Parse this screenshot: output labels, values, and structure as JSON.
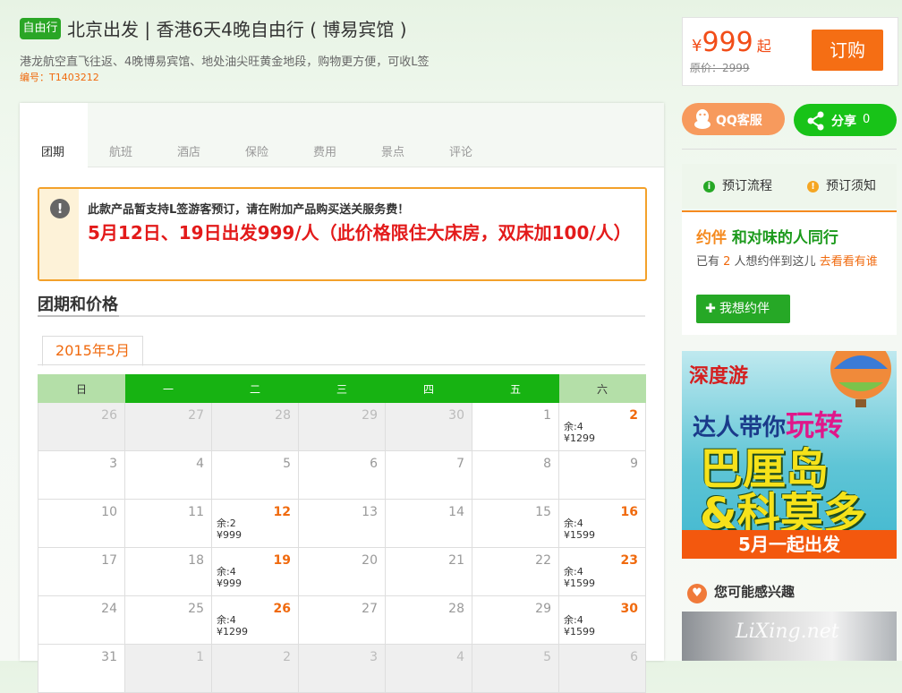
{
  "header": {
    "badge": "自由行",
    "title": "北京出发 | 香港6天4晚自由行 ( 博易宾馆 )",
    "subtitle": "港龙航空直飞往返、4晚博易宾馆、地处油尖旺黄金地段，购物更方便，可收L签",
    "code": "编号：T1403212"
  },
  "price": {
    "currency": "¥",
    "amount": "999",
    "suffix": "起",
    "original": "原价：2999",
    "buy_label": "订购"
  },
  "social": {
    "qq_label": "QQ客服",
    "share_label": "分享",
    "share_count": "0"
  },
  "process": {
    "booking_flow": "预订流程",
    "booking_notes": "预订须知"
  },
  "companion": {
    "logo": "约伴",
    "title": "和对味的人同行",
    "text_prefix": "已有 ",
    "count": "2",
    "text_mid": " 人想约伴到这儿 ",
    "link": "去看看有谁",
    "button": "我想约伴"
  },
  "ad": {
    "logo": "深度游",
    "line1_a": "达人带你",
    "line1_b": "玩转",
    "line2": "巴厘岛",
    "line3": "&科莫多",
    "bar": "5月一起出发"
  },
  "interest": {
    "title": "您可能感兴趣",
    "watermark": "LiXing.net"
  },
  "tabs": [
    "团期",
    "航班",
    "酒店",
    "保险",
    "费用",
    "景点",
    "评论"
  ],
  "notice": {
    "line1": "此款产品暂支持L签游客预订，请在附加产品购买送关服务费！",
    "line2": "5月12日、19日出发999/人（此价格限住大床房，双床加100/人）"
  },
  "section": {
    "title": "团期和价格",
    "month": "2015年5月"
  },
  "calendar": {
    "weekdays": [
      "日",
      "一",
      "二",
      "三",
      "四",
      "五",
      "六"
    ],
    "weeks": [
      [
        {
          "d": "26",
          "g": true
        },
        {
          "d": "27",
          "g": true
        },
        {
          "d": "28",
          "g": true
        },
        {
          "d": "29",
          "g": true
        },
        {
          "d": "30",
          "g": true
        },
        {
          "d": "1"
        },
        {
          "d": "2",
          "rem": "余:4",
          "price": "¥1299"
        }
      ],
      [
        {
          "d": "3"
        },
        {
          "d": "4"
        },
        {
          "d": "5"
        },
        {
          "d": "6"
        },
        {
          "d": "7"
        },
        {
          "d": "8"
        },
        {
          "d": "9"
        }
      ],
      [
        {
          "d": "10"
        },
        {
          "d": "11"
        },
        {
          "d": "12",
          "rem": "余:2",
          "price": "¥999"
        },
        {
          "d": "13"
        },
        {
          "d": "14"
        },
        {
          "d": "15"
        },
        {
          "d": "16",
          "rem": "余:4",
          "price": "¥1599"
        }
      ],
      [
        {
          "d": "17"
        },
        {
          "d": "18"
        },
        {
          "d": "19",
          "rem": "余:4",
          "price": "¥999"
        },
        {
          "d": "20"
        },
        {
          "d": "21"
        },
        {
          "d": "22"
        },
        {
          "d": "23",
          "rem": "余:4",
          "price": "¥1599"
        }
      ],
      [
        {
          "d": "24"
        },
        {
          "d": "25"
        },
        {
          "d": "26",
          "rem": "余:4",
          "price": "¥1299"
        },
        {
          "d": "27"
        },
        {
          "d": "28"
        },
        {
          "d": "29"
        },
        {
          "d": "30",
          "rem": "余:4",
          "price": "¥1599"
        }
      ],
      [
        {
          "d": "31"
        },
        {
          "d": "1",
          "g": true
        },
        {
          "d": "2",
          "g": true
        },
        {
          "d": "3",
          "g": true
        },
        {
          "d": "4",
          "g": true
        },
        {
          "d": "5",
          "g": true
        },
        {
          "d": "6",
          "g": true
        }
      ]
    ]
  }
}
